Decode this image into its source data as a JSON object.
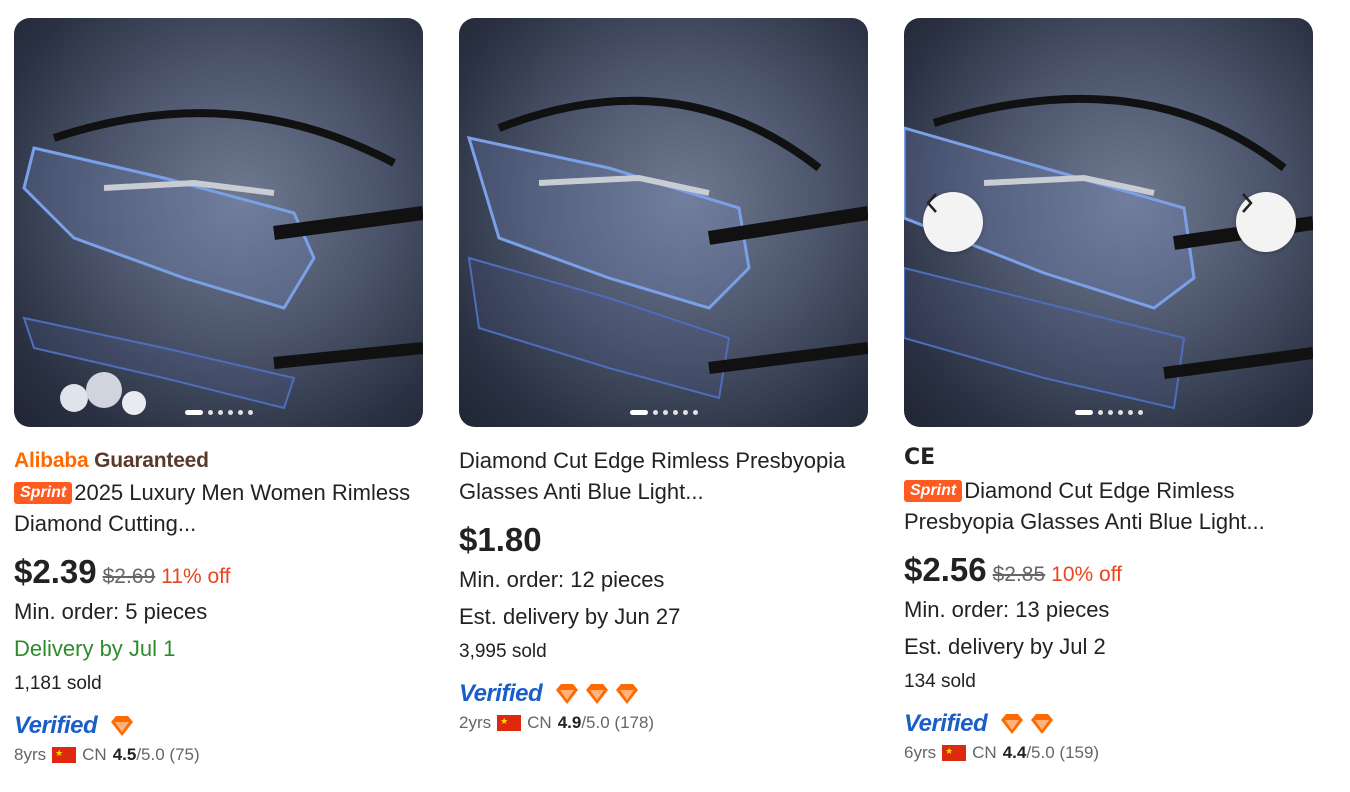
{
  "products": [
    {
      "guarantee": {
        "alibaba": "Alibaba",
        "guaranteed": "Guaranteed"
      },
      "sprint_badge": "Sprint",
      "title": "2025 Luxury Men Women Rimless Diamond Cutting...",
      "price": "$2.39",
      "old_price": "$2.69",
      "discount": "11% off",
      "min_order": "Min. order: 5 pieces",
      "delivery": "Delivery by Jul 1",
      "sold": "1,181 sold",
      "verified": "Verified",
      "years": "8yrs",
      "country": "CN",
      "rating": "4.5",
      "rating_rest": "/5.0 (75)",
      "diamond_count": 1,
      "image_dots": 6
    },
    {
      "title": "Diamond Cut Edge Rimless Presbyopia Glasses Anti Blue Light...",
      "price": "$1.80",
      "min_order": "Min. order: 12 pieces",
      "delivery": "Est. delivery by Jun 27",
      "sold": "3,995 sold",
      "verified": "Verified",
      "years": "2yrs",
      "country": "CN",
      "rating": "4.9",
      "rating_rest": "/5.0 (178)",
      "diamond_count": 3,
      "image_dots": 6
    },
    {
      "cert_mark": "CE",
      "sprint_badge": "Sprint",
      "title": "Diamond Cut Edge Rimless Presbyopia Glasses Anti Blue Light...",
      "price": "$2.56",
      "old_price": "$2.85",
      "discount": "10% off",
      "min_order": "Min. order: 13 pieces",
      "delivery": "Est. delivery by Jul 2",
      "sold": "134 sold",
      "verified": "Verified",
      "years": "6yrs",
      "country": "CN",
      "rating": "4.4",
      "rating_rest": "/5.0 (159)",
      "diamond_count": 2,
      "image_dots": 6
    }
  ],
  "colors": {
    "accent": "#ff6a00",
    "verified_blue": "#1a5fc8",
    "discount_red": "#e8461e",
    "delivery_green": "#2e8b2e"
  }
}
